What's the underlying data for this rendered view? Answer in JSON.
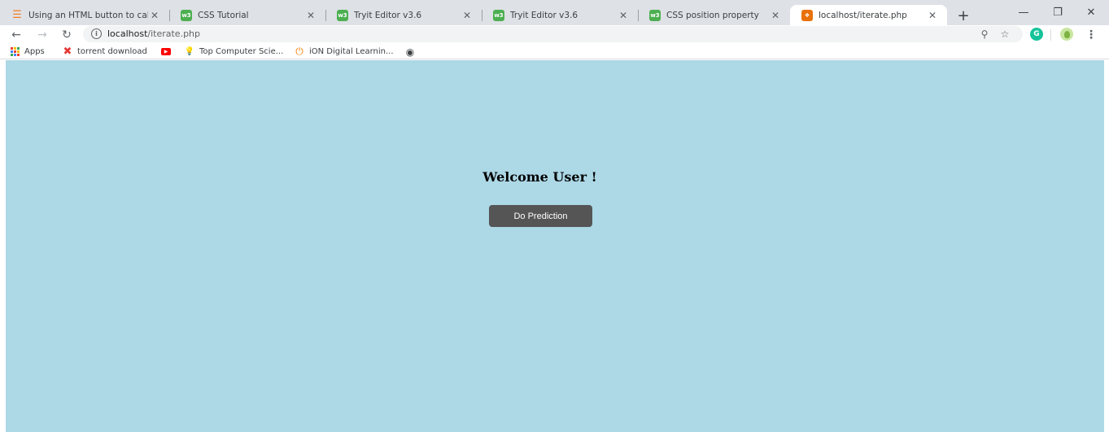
{
  "browser": {
    "tabs": [
      {
        "title": "Using an HTML button to cal",
        "icon": "stackoverflow-icon",
        "active": false
      },
      {
        "title": "CSS Tutorial",
        "icon": "w3schools-icon",
        "active": false
      },
      {
        "title": "Tryit Editor v3.6",
        "icon": "w3schools-icon",
        "active": false
      },
      {
        "title": "Tryit Editor v3.6",
        "icon": "w3schools-icon",
        "active": false
      },
      {
        "title": "CSS position property",
        "icon": "w3schools-icon",
        "active": false
      },
      {
        "title": "localhost/iterate.php",
        "icon": "xampp-icon",
        "active": true
      }
    ],
    "close_glyph": "✕",
    "new_tab_glyph": "+",
    "address": {
      "host": "localhost",
      "path": "/iterate.php"
    },
    "bookmarks": [
      {
        "label": "Apps",
        "icon": "apps-grid-icon"
      },
      {
        "label": "torrent download",
        "icon": "x-icon"
      },
      {
        "label": "",
        "icon": "youtube-icon"
      },
      {
        "label": "Top Computer Scie...",
        "icon": "lightbulb-icon"
      },
      {
        "label": "iON Digital Learnin...",
        "icon": "ion-icon"
      },
      {
        "label": "",
        "icon": "globe-icon"
      }
    ],
    "extension_badges": {
      "grammarly": "G"
    }
  },
  "page": {
    "background_color": "#add8e6",
    "heading": "Welcome User !",
    "button_label": "Do Prediction",
    "button_color": "#555555"
  }
}
